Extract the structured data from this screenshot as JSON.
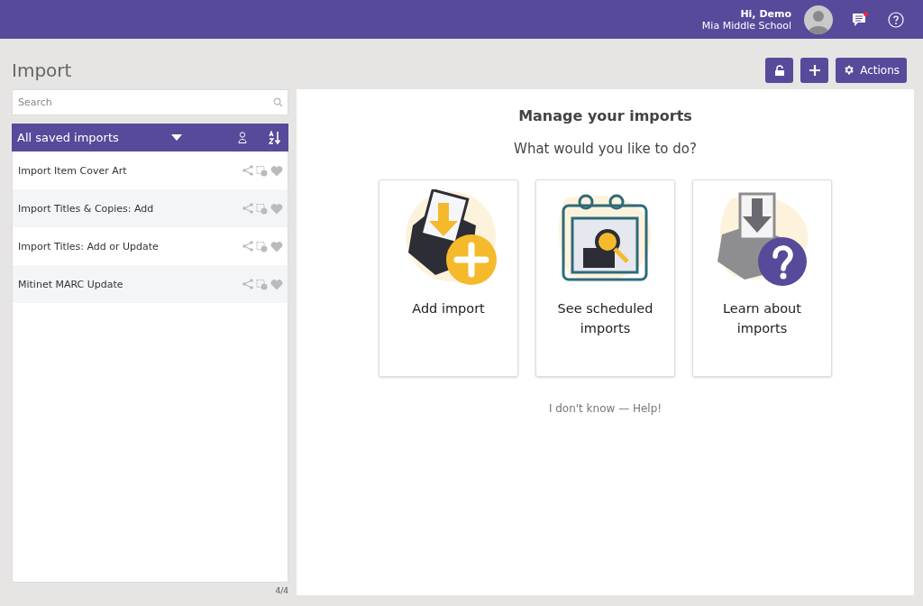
{
  "header": {
    "greeting": "Hi, Demo",
    "school": "Mia Middle School",
    "unread_messages": true
  },
  "page": {
    "title": "Import"
  },
  "toolbar": {
    "actions_label": "Actions"
  },
  "sidebar": {
    "search": {
      "placeholder": "Search"
    },
    "filter": {
      "label": "All saved imports"
    },
    "items": [
      {
        "name": "Import Item Cover Art"
      },
      {
        "name": "Import Titles & Copies: Add"
      },
      {
        "name": "Import Titles: Add or Update"
      },
      {
        "name": "Mitinet MARC Update"
      }
    ],
    "count": "4/4"
  },
  "main": {
    "title": "Manage your imports",
    "subtitle": "What would you like to do?",
    "cards": [
      {
        "kind": "add",
        "label": "Add import"
      },
      {
        "kind": "scheduled",
        "label": "See scheduled imports"
      },
      {
        "kind": "learn",
        "label": "Learn about imports"
      }
    ],
    "help_link": "I don't know — Help!"
  }
}
